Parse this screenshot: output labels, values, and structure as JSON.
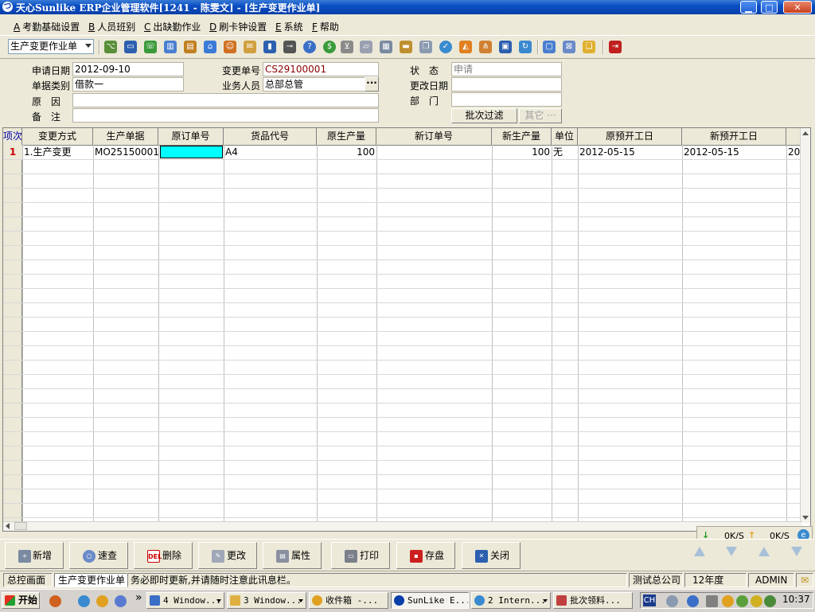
{
  "window": {
    "title": "天心Sunlike ERP企业管理软件[1241 - 陈雯文] - [生产变更作业单]",
    "minimize": "▁",
    "maximize": "□",
    "close": "✕"
  },
  "menu": [
    {
      "key": "A",
      "label": "考勤基础设置"
    },
    {
      "key": "B",
      "label": "人员班别"
    },
    {
      "key": "C",
      "label": "出缺勤作业"
    },
    {
      "key": "D",
      "label": "刷卡钟设置"
    },
    {
      "key": "E",
      "label": "系统"
    },
    {
      "key": "F",
      "label": "帮助"
    }
  ],
  "toolbar": {
    "form_selector": "生产变更作业单",
    "icons": [
      "tree-icon",
      "monitor-icon",
      "phone-icon",
      "building-icon",
      "briefcase-icon",
      "home-icon",
      "people-icon",
      "mail-icon",
      "bookmark-icon",
      "key-icon",
      "help-icon",
      "dollar-icon",
      "cart-icon",
      "document-icon",
      "calculator-icon",
      "archive-icon",
      "copy-icon",
      "check-icon",
      "bell-icon",
      "org-icon",
      "screen-icon",
      "tools-icon",
      "refresh-icon",
      "window-icon",
      "cascade-icon",
      "tile-icon",
      "exit-icon"
    ]
  },
  "header_form": {
    "apply_date_label": "申请日期",
    "apply_date": "2012-09-10",
    "doc_type_label": "单据类别",
    "doc_type": "借款一",
    "reason_label": "原　因",
    "reason": "",
    "remark_label": "备　注",
    "remark": "",
    "change_no_label": "变更单号",
    "change_no": "CS29100001",
    "salesperson_label": "业务人员",
    "salesperson": "总部总管",
    "status_label": "状　态",
    "status": "申请",
    "change_date_label": "更改日期",
    "change_date": "",
    "department_label": "部　门",
    "department": "",
    "batch_filter_button": "批次过滤",
    "other_button": "其它 ···"
  },
  "grid": {
    "columns": [
      "项次",
      "变更方式",
      "生产单据",
      "原订单号",
      "货品代号",
      "原生产量",
      "新订单号",
      "新生产量",
      "单位",
      "原预开工日",
      "新预开工日"
    ],
    "rows": [
      {
        "no": "1",
        "change_method": "1.生产变更",
        "prod_doc": "MO25150001",
        "orig_order": "",
        "item_code": "A4",
        "orig_qty": "100",
        "new_order": "",
        "new_qty": "100",
        "unit": "无",
        "orig_start": "2012-05-15",
        "new_start": "2012-05-15",
        "overflow": "20"
      }
    ]
  },
  "actions": {
    "add": "新增",
    "query": "速查",
    "delete": "删除",
    "modify": "更改",
    "properties": "属性",
    "print": "打印",
    "save": "存盘",
    "close": "关闭",
    "delete_icon_text": "DEL"
  },
  "network": {
    "down": "0K/S",
    "up": "0K/S"
  },
  "statusbar": {
    "home": "总控画面",
    "current_form": "生产变更作业单",
    "message": "务必即时更新,并请随时注意此讯息栏。",
    "company": "测试总公司",
    "fiscal_year": "12年度",
    "user": "ADMIN"
  },
  "taskbar": {
    "start": "开始",
    "chevron": "»",
    "tasks": [
      "4 Window...",
      "3 Window...",
      "收件箱 -...",
      "SunLike E...",
      "2 Intern...",
      "批次领料..."
    ],
    "lang": "CH",
    "clock": "10:37"
  },
  "colors": {
    "title": "#0a3ea8",
    "selected_cell": "#00ffff",
    "row_marker": "#cc0000"
  }
}
